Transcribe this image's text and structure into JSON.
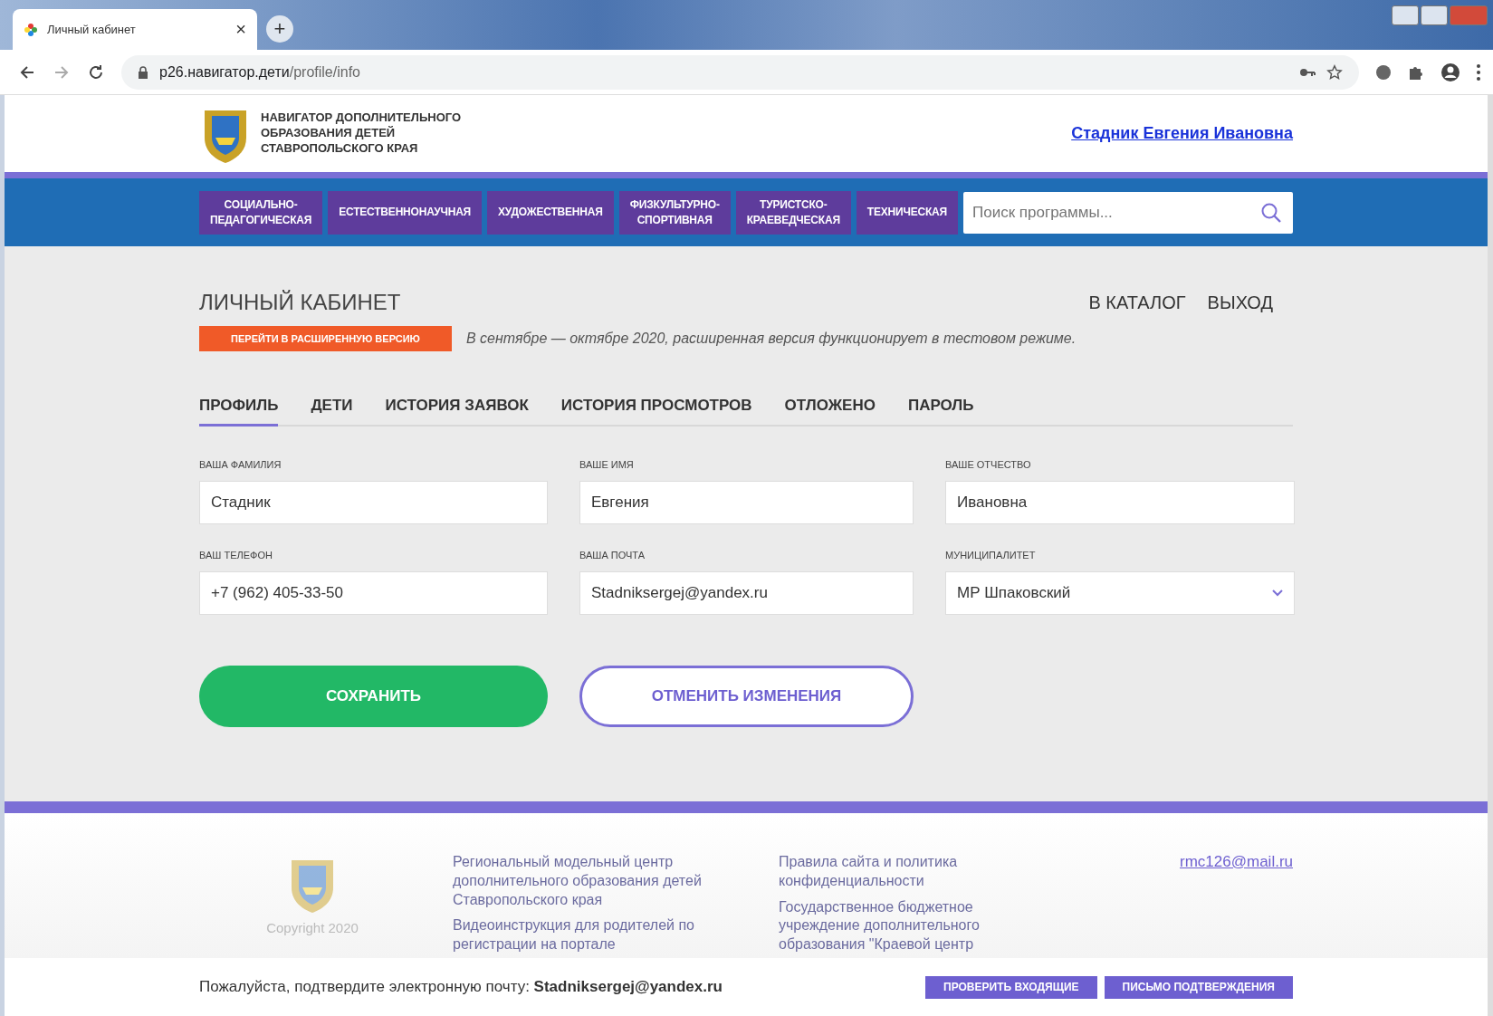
{
  "browser": {
    "tab_title": "Личный кабинет",
    "tab_close": "×",
    "new_tab": "+",
    "address": {
      "host": "p26.навигатор.дети",
      "path": "/profile/info"
    }
  },
  "header": {
    "logo_text": "НАВИГАТОР ДОПОЛНИТЕЛЬНОГО ОБРАЗОВАНИЯ ДЕТЕЙ СТАВРОПОЛЬСКОГО КРАЯ",
    "user_link": "Стадник Евгения Ивановна"
  },
  "categories": [
    "СОЦИАЛЬНО-\nПЕДАГОГИЧЕСКАЯ",
    "ЕСТЕСТВЕННОНАУЧНАЯ",
    "ХУДОЖЕСТВЕННАЯ",
    "ФИЗКУЛЬТУРНО-\nСПОРТИВНАЯ",
    "ТУРИСТСКО-\nКРАЕВЕДЧЕСКАЯ",
    "ТЕХНИЧЕСКАЯ"
  ],
  "search": {
    "placeholder": "Поиск программы..."
  },
  "page": {
    "title": "ЛИЧНЫЙ КАБИНЕТ",
    "links": [
      "В КАТАЛОГ",
      "ВЫХОД"
    ],
    "extended_button": "ПЕРЕЙТИ В РАСШИРЕННУЮ ВЕРСИЮ",
    "notice": "В сентябре — октябре 2020, расширенная версия функционирует в тестовом режиме."
  },
  "tabs": [
    {
      "label": "ПРОФИЛЬ",
      "selected": true
    },
    {
      "label": "ДЕТИ",
      "selected": false
    },
    {
      "label": "ИСТОРИЯ ЗАЯВОК",
      "selected": false
    },
    {
      "label": "ИСТОРИЯ ПРОСМОТРОВ",
      "selected": false
    },
    {
      "label": "ОТЛОЖЕНО",
      "selected": false
    },
    {
      "label": "ПАРОЛЬ",
      "selected": false
    }
  ],
  "fields": [
    {
      "label": "ВАША ФАМИЛИЯ",
      "value": "Стадник",
      "kind": "input"
    },
    {
      "label": "ВАШЕ ИМЯ",
      "value": "Евгения",
      "kind": "input"
    },
    {
      "label": "ВАШЕ ОТЧЕСТВО",
      "value": "Ивановна",
      "kind": "input"
    },
    {
      "label": "ВАШ ТЕЛЕФОН",
      "value": "+7 (962) 405-33-50",
      "kind": "input"
    },
    {
      "label": "ВАША ПОЧТА",
      "value": "Stadniksergej@yandex.ru",
      "kind": "input"
    },
    {
      "label": "МУНИЦИПАЛИТЕТ",
      "value": "МР Шпаковский",
      "kind": "select"
    }
  ],
  "buttons": {
    "save": "СОХРАНИТЬ",
    "cancel": "ОТМЕНИТЬ ИЗМЕНЕНИЯ"
  },
  "footer": {
    "copyright": "Copyright 2020",
    "col1": [
      "Региональный модельный центр дополнительного образования детей Ставропольского края",
      "Видеоинструкция для родителей по регистрации на портале"
    ],
    "col2": [
      "Правила сайта и политика конфиденциальности",
      "Государственное бюджетное учреждение дополнительного образования \"Краевой центр"
    ],
    "email": "rmc126@mail.ru"
  },
  "confirm_bar": {
    "text": "Пожалуйста, подтвердите электронную почту: **Stadniksergej@yandex.ru**",
    "buttons": [
      "ПРОВЕРИТЬ ВХОДЯЩИЕ",
      "ПИСЬМО ПОДТВЕРЖДЕНИЯ"
    ]
  }
}
